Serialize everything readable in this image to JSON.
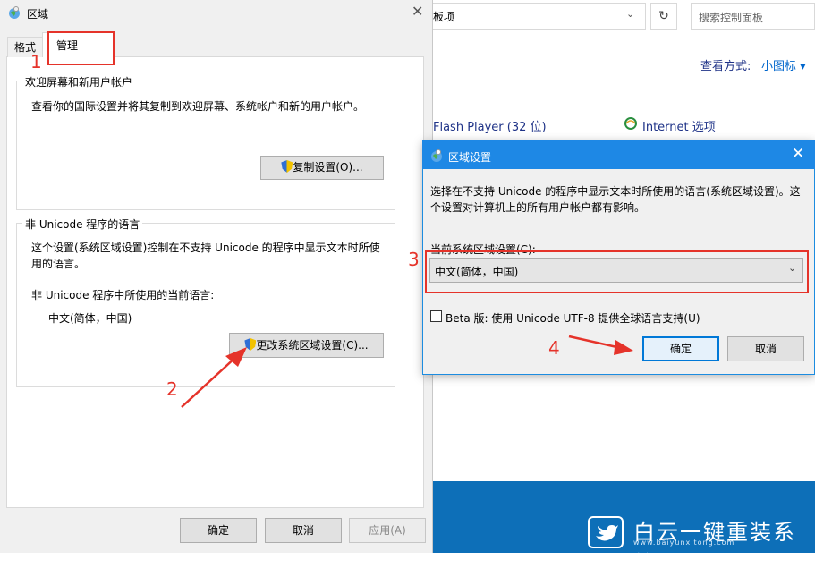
{
  "control_panel": {
    "address_fragment": "板项",
    "search_placeholder": "搜索控制面板",
    "view_by_label": "查看方式:",
    "view_by_value": "小图标 ▾",
    "items": [
      "Flash Player (32 位)",
      "Internet 选项"
    ]
  },
  "region_dialog": {
    "title": "区域",
    "tabs": [
      "格式",
      "管理"
    ],
    "welcome_group": {
      "title": "欢迎屏幕和新用户帐户",
      "description": "查看你的国际设置并将其复制到欢迎屏幕、系统帐户和新的用户帐户。",
      "copy_button": "复制设置(O)..."
    },
    "non_unicode_group": {
      "title": "非 Unicode 程序的语言",
      "description": "这个设置(系统区域设置)控制在不支持 Unicode 的程序中显示文本时所使用的语言。",
      "current_label": "非 Unicode 程序中所使用的当前语言:",
      "current_value": "中文(简体，中国)",
      "change_button": "更改系统区域设置(C)..."
    },
    "buttons": {
      "ok": "确定",
      "cancel": "取消",
      "apply": "应用(A)"
    }
  },
  "locale_dialog": {
    "title": "区域设置",
    "description": "选择在不支持 Unicode 的程序中显示文本时所使用的语言(系统区域设置)。这个设置对计算机上的所有用户帐户都有影响。",
    "current_label": "当前系统区域设置(C):",
    "selected_locale": "中文(简体，中国)",
    "beta_checkbox": "Beta 版: 使用 Unicode UTF-8 提供全球语言支持(U)",
    "beta_checked": false,
    "ok_button": "确定",
    "cancel_button": "取消"
  },
  "annotations": [
    "1",
    "2",
    "3",
    "4"
  ],
  "watermark": {
    "text": "白云一键重装系统",
    "url": "www.baiyunxitong.com"
  },
  "colors": {
    "accent": "#0078d7",
    "annotation": "#e5332a",
    "titlebar": "#1e88e5"
  }
}
